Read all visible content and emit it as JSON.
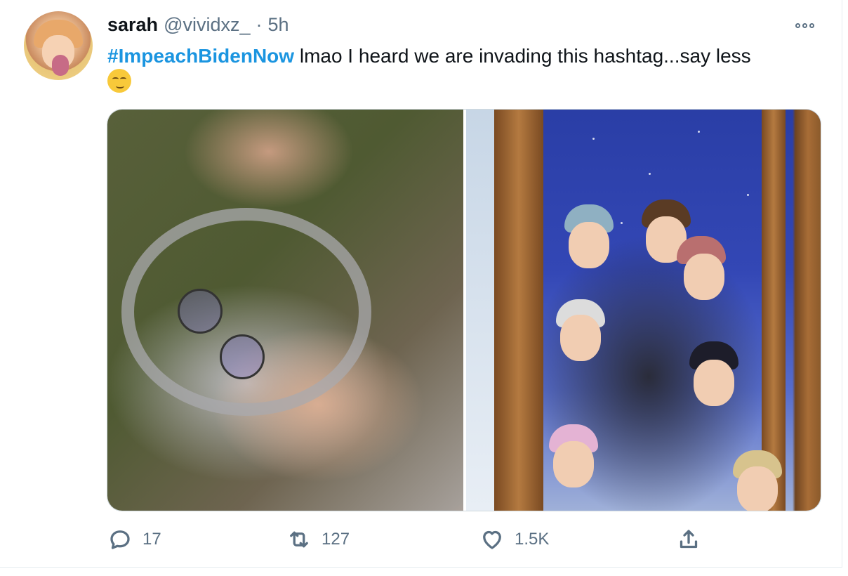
{
  "tweet": {
    "author_name": "sarah",
    "author_handle": "@vividxz_",
    "separator": "·",
    "time": "5h",
    "hashtag": "#ImpeachBidenNow",
    "body": " lmao I heard we are invading this hashtag...say less",
    "emoji": "smirking-face"
  },
  "actions": {
    "reply_count": "17",
    "retweet_count": "127",
    "like_count": "1.5K"
  },
  "colors": {
    "hashtag": "#1b95e0",
    "secondary_text": "#5b7083",
    "border": "#cfd9de"
  }
}
